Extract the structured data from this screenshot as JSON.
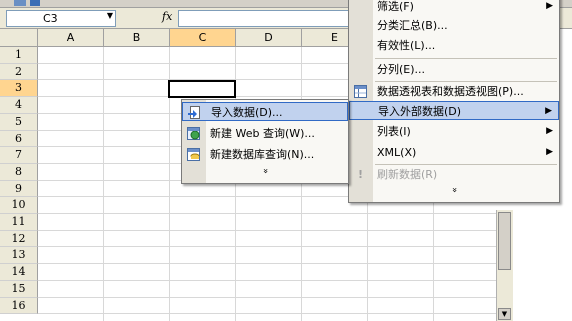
{
  "namebox": {
    "value": "C3"
  },
  "formula": {
    "fx_label": "fx",
    "content": ""
  },
  "columns": [
    "A",
    "B",
    "C",
    "D",
    "E"
  ],
  "active_column": "C",
  "rows": [
    "1",
    "2",
    "3",
    "4",
    "5",
    "6",
    "7",
    "8",
    "9",
    "10",
    "11",
    "12",
    "13",
    "14",
    "15",
    "16"
  ],
  "active_row": "3",
  "data_menu": {
    "items": [
      {
        "label": "筛选(F)",
        "submenu": true
      },
      {
        "label": "分类汇总(B)..."
      },
      {
        "label": "有效性(L)..."
      },
      {
        "label": "分列(E)..."
      },
      {
        "label": "数据透视表和数据透视图(P)..."
      },
      {
        "label": "导入外部数据(D)",
        "submenu": true,
        "highlighted": true
      },
      {
        "label": "列表(I)",
        "submenu": true
      },
      {
        "label": "XML(X)",
        "submenu": true
      },
      {
        "label": "刷新数据(R)",
        "disabled": true
      }
    ],
    "expand_glyph": "»"
  },
  "import_submenu": {
    "items": [
      {
        "label": "导入数据(D)...",
        "highlighted": true
      },
      {
        "label": "新建 Web 查询(W)..."
      },
      {
        "label": "新建数据库查询(N)..."
      }
    ],
    "expand_glyph": "»"
  },
  "colors": {
    "highlight": "#c1d2ee",
    "highlight_border": "#316ac5",
    "header_active": "#ffd590"
  }
}
